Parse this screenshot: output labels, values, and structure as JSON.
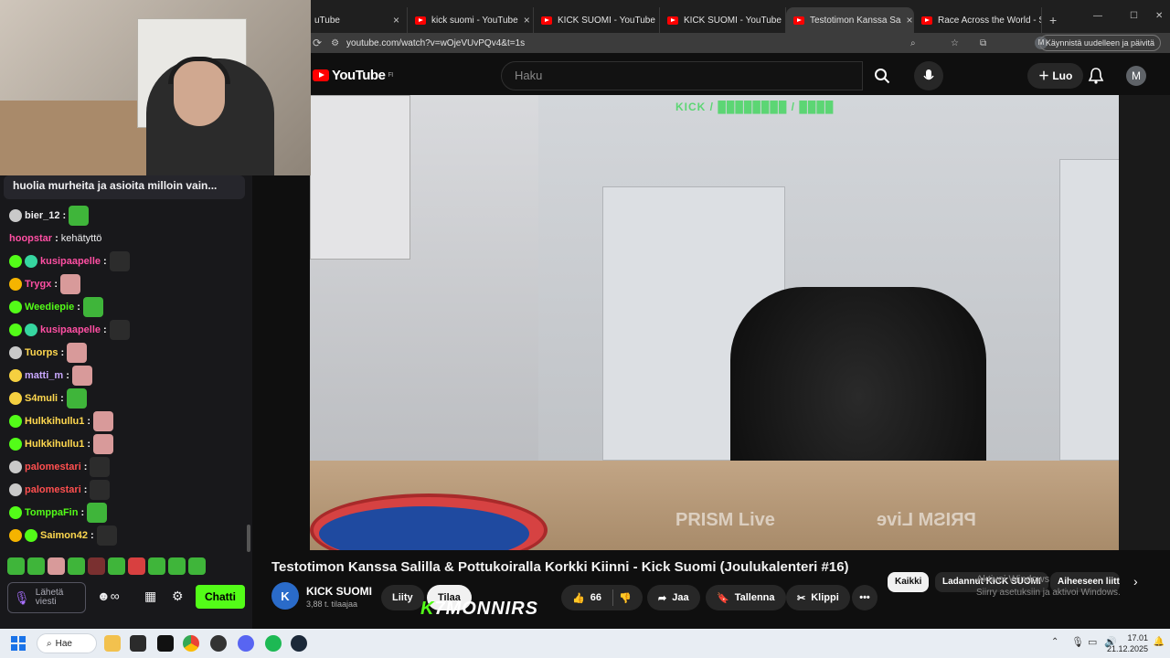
{
  "browser": {
    "tabs": [
      {
        "label": "uTube",
        "active": false
      },
      {
        "label": "kick suomi - YouTube",
        "active": false
      },
      {
        "label": "KICK SUOMI - YouTube",
        "active": false
      },
      {
        "label": "KICK SUOMI - YouTube",
        "active": false
      },
      {
        "label": "Testotimon Kanssa Sa",
        "active": true
      },
      {
        "label": "Race Across the World - S",
        "active": false
      }
    ],
    "url": "youtube.com/watch?v=wOjeVUvPQv4&t=1s",
    "restart_label": "Käynnistä uudelleen ja päivitä",
    "profile_initial": "M"
  },
  "youtube": {
    "logo_text": "YouTube",
    "region": "FI",
    "search_placeholder": "Haku",
    "create_label": "Luo",
    "avatar_initial": "M",
    "video": {
      "overlay_text": "KICK / ████████ / ████",
      "prism_label": "PRISM Live",
      "prism_label_mirrored": "PRISM Live"
    },
    "title": "Testotimon Kanssa Salilla & Pottukoiralla Korkki Kiinni - Kick Suomi (Joulukalenteri #16)",
    "channel": {
      "name": "KICK SUOMI",
      "subscribers": "3,88 t. tilaajaa",
      "initial": "K"
    },
    "join_label": "Liity",
    "subscribe_label": "Tilaa",
    "likes": "66",
    "share_label": "Jaa",
    "save_label": "Tallenna",
    "clip_label": "Klippi",
    "chips": [
      "Kaikki",
      "Ladannut KICK SUOMI",
      "Aiheeseen liitt"
    ],
    "windows_watermark": [
      "Aktivoi Windows",
      "Siirry asetuksiin ja aktivoi Windows."
    ],
    "kick_overlay": "K7MONNIRS"
  },
  "chat": {
    "pinned": "huolia murheita ja asioita milloin vain...",
    "messages": [
      {
        "user": "bier_12",
        "color": "#efeff1",
        "text": "",
        "badges": [
          "#c9c9c9"
        ],
        "emotes": [
          "#3fb53a"
        ]
      },
      {
        "user": "hoopstar",
        "color": "#ff4fa3",
        "text": "kehätyttö",
        "badges": [],
        "emotes": []
      },
      {
        "user": "kusipaapelle",
        "color": "#ff4fa3",
        "text": "",
        "badges": [
          "#53fc18",
          "#36d6a0"
        ],
        "emotes": [
          "#2c2c2c"
        ]
      },
      {
        "user": "Trygx",
        "color": "#ff4fa3",
        "text": "",
        "badges": [
          "#f5b400"
        ],
        "emotes": [
          "#d89a9a"
        ]
      },
      {
        "user": "Weediepie",
        "color": "#53fc18",
        "text": "",
        "badges": [
          "#53fc18"
        ],
        "emotes": [
          "#3fb53a"
        ]
      },
      {
        "user": "kusipaapelle",
        "color": "#ff4fa3",
        "text": "",
        "badges": [
          "#53fc18",
          "#36d6a0"
        ],
        "emotes": [
          "#2c2c2c"
        ]
      },
      {
        "user": "Tuorps",
        "color": "#ffd84f",
        "text": "",
        "badges": [
          "#c9c9c9"
        ],
        "emotes": [
          "#d89a9a"
        ]
      },
      {
        "user": "matti_m",
        "color": "#c9a8ff",
        "text": "",
        "badges": [
          "#f5d040"
        ],
        "emotes": [
          "#d89a9a"
        ]
      },
      {
        "user": "S4muli",
        "color": "#ffd84f",
        "text": "",
        "badges": [
          "#f5d040"
        ],
        "emotes": [
          "#3fb53a"
        ]
      },
      {
        "user": "Hulkkihullu1",
        "color": "#ffd84f",
        "text": "",
        "badges": [
          "#53fc18"
        ],
        "emotes": [
          "#d89a9a"
        ]
      },
      {
        "user": "Hulkkihullu1",
        "color": "#ffd84f",
        "text": "",
        "badges": [
          "#53fc18"
        ],
        "emotes": [
          "#d89a9a"
        ]
      },
      {
        "user": "palomestari",
        "color": "#ff4f4f",
        "text": "",
        "badges": [
          "#c9c9c9"
        ],
        "emotes": [
          "#2c2c2c"
        ]
      },
      {
        "user": "palomestari",
        "color": "#ff4f4f",
        "text": "",
        "badges": [
          "#c9c9c9"
        ],
        "emotes": [
          "#2c2c2c"
        ]
      },
      {
        "user": "TomppaFin",
        "color": "#53fc18",
        "text": "",
        "badges": [
          "#53fc18"
        ],
        "emotes": [
          "#3fb53a"
        ]
      },
      {
        "user": "Saimon42",
        "color": "#ffd84f",
        "text": "",
        "badges": [
          "#f5b400",
          "#53fc18"
        ],
        "emotes": [
          "#2c2c2c"
        ]
      }
    ],
    "input_placeholder": "Lähetä viesti",
    "send_label": "Chatti",
    "emote_bar": [
      "#3fb53a",
      "#3fb53a",
      "#d89a9a",
      "#3fb53a",
      "#7a3030",
      "#3fb53a",
      "#d84040",
      "#3fb53a",
      "#3fb53a",
      "#3fb53a"
    ]
  },
  "taskbar": {
    "search_label": "Hae",
    "time": "17.01",
    "date": "21.12.2025"
  }
}
